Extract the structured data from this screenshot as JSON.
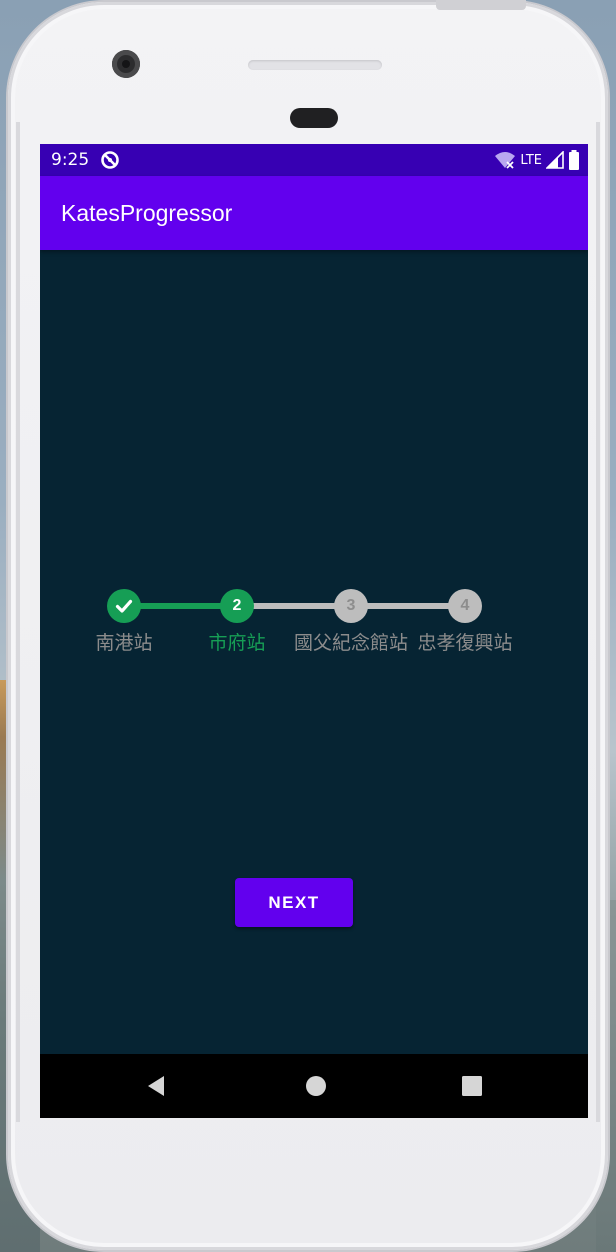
{
  "status_bar": {
    "time": "9:25",
    "network_label": "LTE",
    "icons": [
      "sync-disabled-icon",
      "wifi-icon",
      "signal-icon",
      "battery-icon"
    ]
  },
  "app_bar": {
    "title": "KatesProgressor"
  },
  "stepper": {
    "current_step": 2,
    "steps": [
      {
        "number": "1",
        "label": "南港站",
        "state": "completed",
        "icon": "check-icon"
      },
      {
        "number": "2",
        "label": "市府站",
        "state": "current"
      },
      {
        "number": "3",
        "label": "國父紀念館站",
        "state": "pending"
      },
      {
        "number": "4",
        "label": "忠孝復興站",
        "state": "pending"
      }
    ],
    "colors": {
      "active": "#169e55",
      "inactive": "#bdbdbd",
      "inactive_text": "#8d8d8d",
      "label_inactive": "#8c8c8c",
      "label_active": "#169e55"
    }
  },
  "actions": {
    "next_label": "NEXT"
  },
  "nav_bar": {
    "icons": [
      "back-icon",
      "home-icon",
      "recents-icon"
    ]
  },
  "colors": {
    "status_bar": "#3700b3",
    "app_bar": "#6200ee",
    "screen_background": "#062433",
    "button": "#6200ee"
  }
}
